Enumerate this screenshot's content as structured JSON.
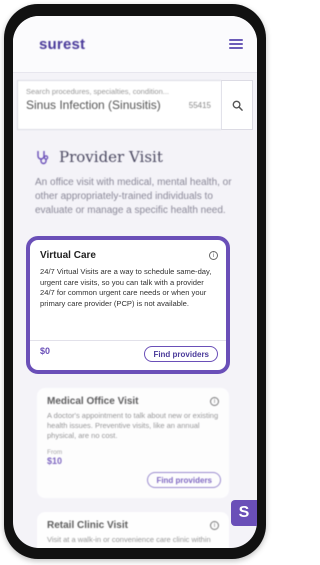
{
  "header": {
    "logo": "surest",
    "menu_icon": "hamburger-icon"
  },
  "search": {
    "placeholder": "Search procedures, specialties, condition...",
    "value": "Sinus Infection (Sinusitis)",
    "zip": "55415",
    "icon": "search-icon"
  },
  "section": {
    "icon": "stethoscope-icon",
    "title": "Provider Visit",
    "intro": "An office visit with medical, mental health, or other appropriately-trained individuals to evaluate or manage a specific health need."
  },
  "cards": [
    {
      "title": "Virtual Care",
      "description": "24/7 Virtual Visits are a way to schedule same-day, urgent care visits, so you can talk with a provider 24/7 for common urgent care needs or when your primary care provider (PCP) is not available.",
      "price": "$0",
      "button": "Find providers"
    },
    {
      "title": "Medical Office Visit",
      "description": "A doctor's appointment to talk about new or existing health issues. Preventive visits, like an annual physical, are no cost.",
      "from_label": "From",
      "price": "$10",
      "button": "Find providers"
    },
    {
      "title": "Retail Clinic Visit",
      "description": "Visit at a walk-in or convenience care clinic within"
    }
  ],
  "chat": {
    "label": "S"
  },
  "colors": {
    "accent": "#6a4fb8",
    "brand": "#4a3a9a",
    "background": "#f4f3f8"
  }
}
